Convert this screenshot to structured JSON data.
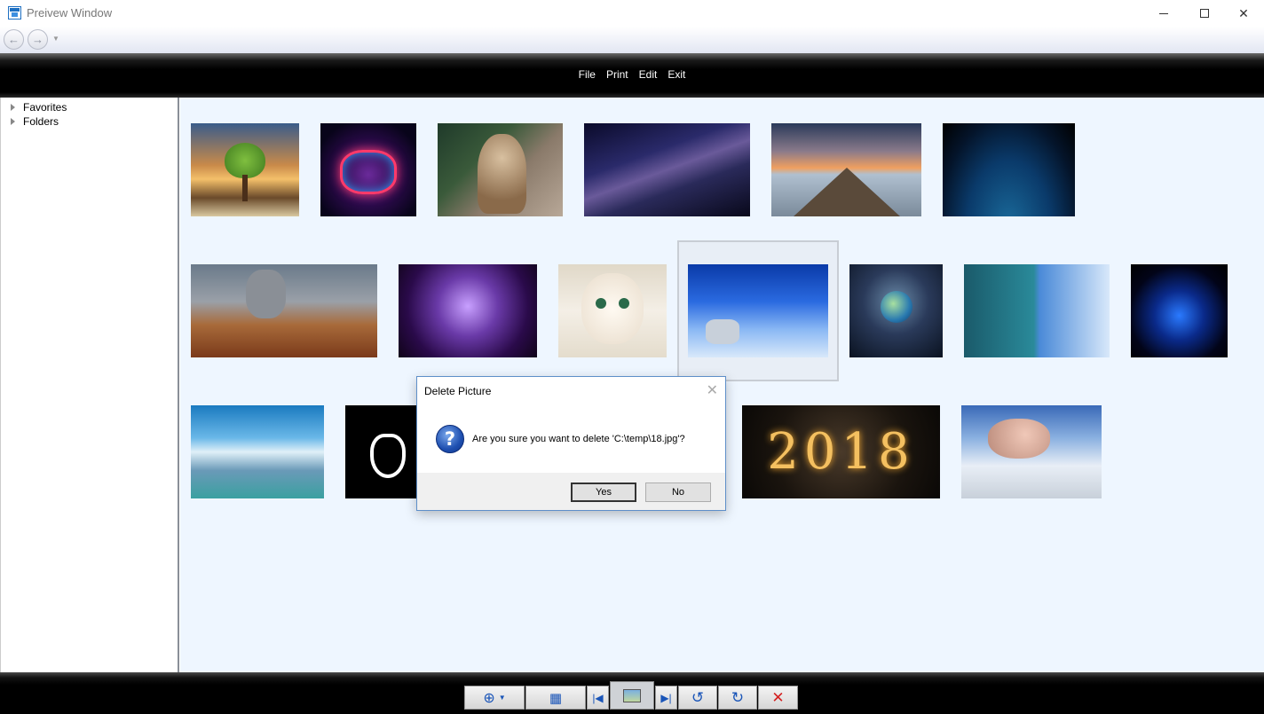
{
  "window": {
    "title": "Preivew Window"
  },
  "menu": {
    "items": [
      "File",
      "Print",
      "Edit",
      "Exit"
    ]
  },
  "tree": {
    "favorites": "Favorites",
    "folders": "Folders"
  },
  "thumbnails": [
    {
      "name": "heart-tree"
    },
    {
      "name": "neon-hearts"
    },
    {
      "name": "kitten-praying"
    },
    {
      "name": "milky-way"
    },
    {
      "name": "pier-sunset"
    },
    {
      "name": "earth-night-city"
    },
    {
      "name": "elephant-man"
    },
    {
      "name": "lightning"
    },
    {
      "name": "white-kitten"
    },
    {
      "name": "airplane-clouds"
    },
    {
      "name": "earth-hand"
    },
    {
      "name": "split-world"
    },
    {
      "name": "blue-fire-heart"
    },
    {
      "name": "mountain-sky"
    },
    {
      "name": "white-heart-sketch"
    },
    {
      "name": "2018-sparkle"
    },
    {
      "name": "flying-pig"
    }
  ],
  "thumb_text": {
    "year": "2018"
  },
  "toolbar": {
    "icons": [
      "zoom-icon",
      "grid-icon",
      "first-icon",
      "image-icon",
      "last-icon",
      "rotate-left-icon",
      "rotate-right-icon",
      "delete-icon"
    ]
  },
  "dialog": {
    "title": "Delete Picture",
    "message": "Are you sure you want to delete 'C:\\temp\\18.jpg'?",
    "yes": "Yes",
    "no": "No"
  },
  "colors": {
    "accent": "#1d6fc2",
    "gallery_bg": "#eef6ff",
    "delete": "#d42020"
  }
}
